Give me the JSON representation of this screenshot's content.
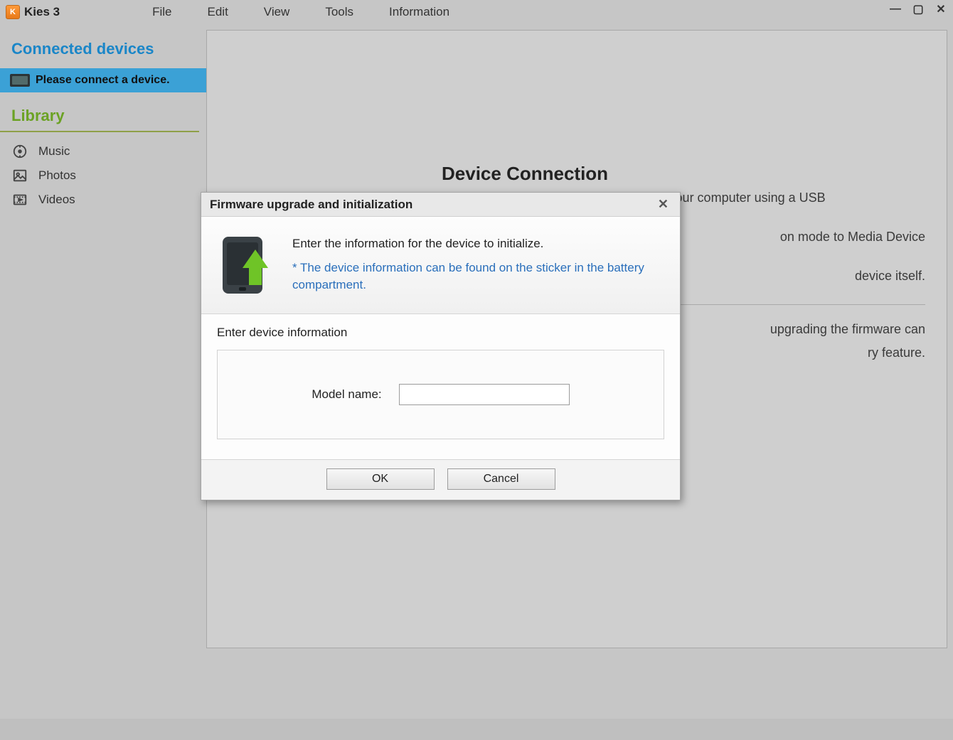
{
  "app": {
    "title": "Kies 3",
    "icon_char": "K"
  },
  "menus": {
    "file": "File",
    "edit": "Edit",
    "view": "View",
    "tools": "Tools",
    "info": "Information"
  },
  "win_controls": {
    "min": "—",
    "max": "▢",
    "close": "✕"
  },
  "sidebar": {
    "connected_heading": "Connected devices",
    "connect_status": "Please connect a device.",
    "library_heading": "Library",
    "items": [
      {
        "label": "Music",
        "icon": "music"
      },
      {
        "label": "Photos",
        "icon": "photo"
      },
      {
        "label": "Videos",
        "icon": "video"
      }
    ]
  },
  "bg": {
    "title": "Device Connection",
    "para1": "You can connect your device to Kies on your computer using a USB",
    "para2_tail": "on mode to Media Device",
    "para3_tail": "device itself.",
    "para4_tail": "upgrading the firmware can",
    "para5_tail": "ry feature."
  },
  "modal": {
    "title": "Firmware upgrade and initialization",
    "line1": "Enter the information for the device to initialize.",
    "note": "* The device information can be found on the sticker in the battery compartment.",
    "section_label": "Enter device information",
    "model_label": "Model name:",
    "model_value": "",
    "ok": "OK",
    "cancel": "Cancel"
  }
}
